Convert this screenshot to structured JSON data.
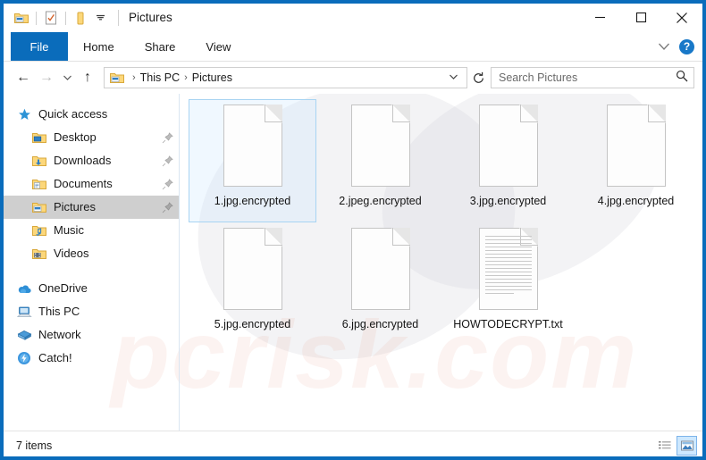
{
  "window": {
    "title": "Pictures",
    "accent_color": "#0a6cbb",
    "selection_color": "#cde8ff"
  },
  "quick_access_toolbar": {
    "items": [
      {
        "name": "pictures-folder-icon",
        "tooltip": "Pictures"
      },
      {
        "name": "properties-icon",
        "tooltip": "Properties"
      },
      {
        "name": "new-folder-icon",
        "tooltip": "New folder"
      },
      {
        "name": "customize-chevron-icon",
        "tooltip": "Customize Quick Access Toolbar"
      }
    ]
  },
  "window_controls": {
    "minimize": "─",
    "maximize": "□",
    "close": "✕"
  },
  "ribbon": {
    "tabs": [
      {
        "label": "File",
        "active": true
      },
      {
        "label": "Home",
        "active": false
      },
      {
        "label": "Share",
        "active": false
      },
      {
        "label": "View",
        "active": false
      }
    ],
    "collapse_icon": "chevron-down-icon",
    "help_label": "?"
  },
  "navigation": {
    "back": "←",
    "forward": "→",
    "recent": "⌄",
    "up": "↑",
    "refresh": "↻",
    "breadcrumb": {
      "icon": "pictures-folder-icon",
      "parts": [
        "This PC",
        "Pictures"
      ],
      "separator": "›",
      "dropdown": "⌄"
    }
  },
  "search": {
    "placeholder": "Search Pictures",
    "value": "",
    "icon": "search-icon"
  },
  "sidebar": {
    "groups": [
      {
        "header": {
          "label": "Quick access",
          "icon": "star-pin-icon"
        },
        "items": [
          {
            "label": "Desktop",
            "icon": "desktop-folder-icon",
            "pinned": true,
            "selected": false
          },
          {
            "label": "Downloads",
            "icon": "downloads-folder-icon",
            "pinned": true,
            "selected": false
          },
          {
            "label": "Documents",
            "icon": "documents-folder-icon",
            "pinned": true,
            "selected": false
          },
          {
            "label": "Pictures",
            "icon": "pictures-folder-icon",
            "pinned": true,
            "selected": true
          },
          {
            "label": "Music",
            "icon": "music-folder-icon",
            "pinned": false,
            "selected": false
          },
          {
            "label": "Videos",
            "icon": "videos-folder-icon",
            "pinned": false,
            "selected": false
          }
        ]
      },
      {
        "header": null,
        "items": [
          {
            "label": "OneDrive",
            "icon": "onedrive-cloud-icon",
            "pinned": false,
            "selected": false
          },
          {
            "label": "This PC",
            "icon": "this-pc-icon",
            "pinned": false,
            "selected": false
          },
          {
            "label": "Network",
            "icon": "network-icon",
            "pinned": false,
            "selected": false
          },
          {
            "label": "Catch!",
            "icon": "catch-app-icon",
            "pinned": false,
            "selected": false
          }
        ]
      }
    ]
  },
  "files": [
    {
      "name": "1.jpg.encrypted",
      "icon": "blank-document-icon",
      "selected": true
    },
    {
      "name": "2.jpeg.encrypted",
      "icon": "blank-document-icon",
      "selected": false
    },
    {
      "name": "3.jpg.encrypted",
      "icon": "blank-document-icon",
      "selected": false
    },
    {
      "name": "4.jpg.encrypted",
      "icon": "blank-document-icon",
      "selected": false
    },
    {
      "name": "5.jpg.encrypted",
      "icon": "blank-document-icon",
      "selected": false
    },
    {
      "name": "6.jpg.encrypted",
      "icon": "blank-document-icon",
      "selected": false
    },
    {
      "name": "HOWTODECRYPT.txt",
      "icon": "text-document-icon",
      "selected": false
    }
  ],
  "statusbar": {
    "item_count": "7 items",
    "views": [
      {
        "name": "details-view-button",
        "active": false
      },
      {
        "name": "large-icons-view-button",
        "active": true
      }
    ]
  },
  "watermark": {
    "text": "pcrisk.com"
  }
}
